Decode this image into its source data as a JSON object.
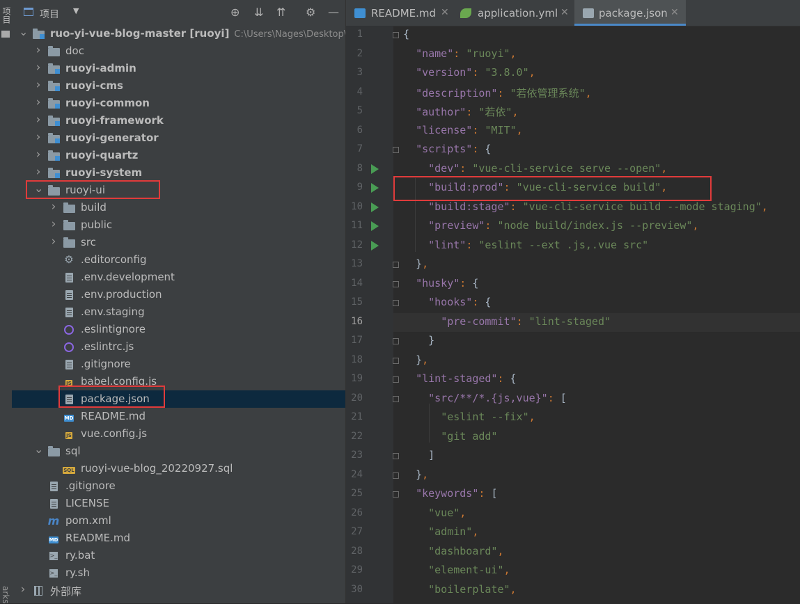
{
  "side_strip": {
    "top_label": "项目",
    "bottom_label": "arks"
  },
  "project_panel": {
    "title": "项目",
    "tools": [
      "crosshair-icon",
      "expand-all-icon",
      "collapse-all-icon",
      "gear-icon",
      "minimize-icon"
    ],
    "tree": [
      {
        "label": "ruo-yi-vue-blog-master",
        "suffix": "[ruoyi]",
        "path": "C:\\Users\\Nages\\Desktop\\r",
        "expanded": true
      },
      {
        "label": "doc"
      },
      {
        "label": "ruoyi-admin"
      },
      {
        "label": "ruoyi-cms"
      },
      {
        "label": "ruoyi-common"
      },
      {
        "label": "ruoyi-framework"
      },
      {
        "label": "ruoyi-generator"
      },
      {
        "label": "ruoyi-quartz"
      },
      {
        "label": "ruoyi-system"
      },
      {
        "label": "ruoyi-ui",
        "expanded": true,
        "highlighted": true
      },
      {
        "label": "build"
      },
      {
        "label": "public"
      },
      {
        "label": "src"
      },
      {
        "label": ".editorconfig"
      },
      {
        "label": ".env.development"
      },
      {
        "label": ".env.production"
      },
      {
        "label": ".env.staging"
      },
      {
        "label": ".eslintignore"
      },
      {
        "label": ".eslintrc.js"
      },
      {
        "label": ".gitignore"
      },
      {
        "label": "babel.config.js"
      },
      {
        "label": "package.json",
        "selected": true,
        "highlighted": true
      },
      {
        "label": "README.md"
      },
      {
        "label": "vue.config.js"
      },
      {
        "label": "sql",
        "expanded": true
      },
      {
        "label": "ruoyi-vue-blog_20220927.sql"
      },
      {
        "label": ".gitignore"
      },
      {
        "label": "LICENSE"
      },
      {
        "label": "pom.xml"
      },
      {
        "label": "README.md"
      },
      {
        "label": "ry.bat"
      },
      {
        "label": "ry.sh"
      },
      {
        "label": "外部库"
      }
    ]
  },
  "editor": {
    "tabs": [
      {
        "label": "README.md",
        "icon": "markdown-icon",
        "active": false
      },
      {
        "label": "application.yml",
        "icon": "spring-leaf-icon",
        "active": false
      },
      {
        "label": "package.json",
        "icon": "json-config-icon",
        "active": true
      }
    ],
    "current_line": 16,
    "line_numbers": [
      "1",
      "2",
      "3",
      "4",
      "5",
      "6",
      "7",
      "8",
      "9",
      "10",
      "11",
      "12",
      "13",
      "14",
      "15",
      "16",
      "17",
      "18",
      "19",
      "20",
      "21",
      "22",
      "23",
      "24",
      "25",
      "26",
      "27",
      "28",
      "29",
      "30"
    ],
    "lines": [
      {
        "indent": "",
        "key": "",
        "sep": "",
        "val": "",
        "tail": "{"
      },
      {
        "indent": "  ",
        "key": "\"name\"",
        "sep": ": ",
        "val": "\"ruoyi\"",
        "tail": ","
      },
      {
        "indent": "  ",
        "key": "\"version\"",
        "sep": ": ",
        "val": "\"3.8.0\"",
        "tail": ","
      },
      {
        "indent": "  ",
        "key": "\"description\"",
        "sep": ": ",
        "val": "\"若依管理系统\"",
        "tail": ","
      },
      {
        "indent": "  ",
        "key": "\"author\"",
        "sep": ": ",
        "val": "\"若依\"",
        "tail": ","
      },
      {
        "indent": "  ",
        "key": "\"license\"",
        "sep": ": ",
        "val": "\"MIT\"",
        "tail": ","
      },
      {
        "indent": "  ",
        "key": "\"scripts\"",
        "sep": ": ",
        "val": "",
        "tail": "{"
      },
      {
        "indent": "    ",
        "key": "\"dev\"",
        "sep": ": ",
        "val": "\"vue-cli-service serve --open\"",
        "tail": ","
      },
      {
        "indent": "    ",
        "key": "\"build:prod\"",
        "sep": ": ",
        "val": "\"vue-cli-service build\"",
        "tail": ","
      },
      {
        "indent": "    ",
        "key": "\"build:stage\"",
        "sep": ": ",
        "val": "\"vue-cli-service build --mode staging\"",
        "tail": ","
      },
      {
        "indent": "    ",
        "key": "\"preview\"",
        "sep": ": ",
        "val": "\"node build/index.js --preview\"",
        "tail": ","
      },
      {
        "indent": "    ",
        "key": "\"lint\"",
        "sep": ": ",
        "val": "\"eslint --ext .js,.vue src\"",
        "tail": ""
      },
      {
        "indent": "  ",
        "key": "",
        "sep": "",
        "val": "",
        "tail": "},"
      },
      {
        "indent": "  ",
        "key": "\"husky\"",
        "sep": ": ",
        "val": "",
        "tail": "{"
      },
      {
        "indent": "    ",
        "key": "\"hooks\"",
        "sep": ": ",
        "val": "",
        "tail": "{"
      },
      {
        "indent": "      ",
        "key": "\"pre-commit\"",
        "sep": ": ",
        "val": "\"lint-staged\"",
        "tail": ""
      },
      {
        "indent": "    ",
        "key": "",
        "sep": "",
        "val": "",
        "tail": "}"
      },
      {
        "indent": "  ",
        "key": "",
        "sep": "",
        "val": "",
        "tail": "},"
      },
      {
        "indent": "  ",
        "key": "\"lint-staged\"",
        "sep": ": ",
        "val": "",
        "tail": "{"
      },
      {
        "indent": "    ",
        "key": "\"src/**/*.{js,vue}\"",
        "sep": ": ",
        "val": "",
        "tail": "["
      },
      {
        "indent": "      ",
        "key": "",
        "sep": "",
        "val": "\"eslint --fix\"",
        "tail": ","
      },
      {
        "indent": "      ",
        "key": "",
        "sep": "",
        "val": "\"git add\"",
        "tail": ""
      },
      {
        "indent": "    ",
        "key": "",
        "sep": "",
        "val": "",
        "tail": "]"
      },
      {
        "indent": "  ",
        "key": "",
        "sep": "",
        "val": "",
        "tail": "},"
      },
      {
        "indent": "  ",
        "key": "\"keywords\"",
        "sep": ": ",
        "val": "",
        "tail": "["
      },
      {
        "indent": "    ",
        "key": "",
        "sep": "",
        "val": "\"vue\"",
        "tail": ","
      },
      {
        "indent": "    ",
        "key": "",
        "sep": "",
        "val": "\"admin\"",
        "tail": ","
      },
      {
        "indent": "    ",
        "key": "",
        "sep": "",
        "val": "\"dashboard\"",
        "tail": ","
      },
      {
        "indent": "    ",
        "key": "",
        "sep": "",
        "val": "\"element-ui\"",
        "tail": ","
      },
      {
        "indent": "    ",
        "key": "",
        "sep": "",
        "val": "\"boilerplate\"",
        "tail": ","
      }
    ]
  },
  "colors": {
    "json_key": "#9876aa",
    "json_string": "#6a8759",
    "punctuation": "#cc7832",
    "selection": "#0d293e",
    "highlight_box": "#e03b3b",
    "run_marker": "#499c54"
  }
}
